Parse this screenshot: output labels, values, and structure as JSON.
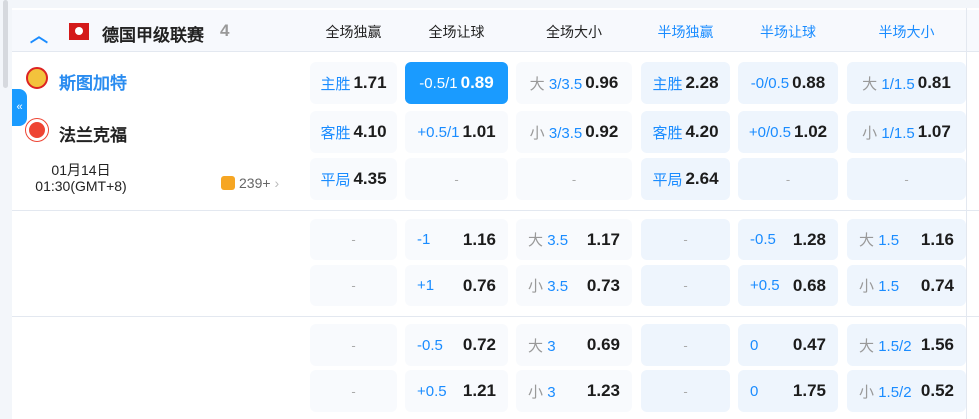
{
  "league": {
    "name": "德国甲级联赛",
    "count": "4",
    "flag_icon": "bundesliga-flag-icon"
  },
  "columns": [
    "全场独赢",
    "全场让球",
    "全场大小",
    "半场独赢",
    "半场让球",
    "半场大小"
  ],
  "match": {
    "home": "斯图加特",
    "away": "法兰克福",
    "date": "01月14日",
    "time": "01:30(GMT+8)",
    "more": "239+"
  },
  "rows": [
    [
      {
        "l": "主胜",
        "v": "1.71"
      },
      {
        "l": "-0.5/1",
        "v": "0.89",
        "selected": true
      },
      {
        "p": "大",
        "l": "3/3.5",
        "v": "0.96"
      },
      {
        "l": "主胜",
        "v": "2.28"
      },
      {
        "l": "-0/0.5",
        "v": "0.88"
      },
      {
        "p": "大",
        "l": "1/1.5",
        "v": "0.81"
      }
    ],
    [
      {
        "l": "客胜",
        "v": "4.10"
      },
      {
        "l": "+0.5/1",
        "v": "1.01"
      },
      {
        "p": "小",
        "l": "3/3.5",
        "v": "0.92"
      },
      {
        "l": "客胜",
        "v": "4.20"
      },
      {
        "l": "+0/0.5",
        "v": "1.02"
      },
      {
        "p": "小",
        "l": "1/1.5",
        "v": "1.07"
      }
    ],
    [
      {
        "l": "平局",
        "v": "4.35"
      },
      {
        "d": "-"
      },
      {
        "d": "-"
      },
      {
        "l": "平局",
        "v": "2.64"
      },
      {
        "d": "-"
      },
      {
        "d": "-"
      }
    ],
    [
      {
        "d": "-"
      },
      {
        "l": "-1",
        "v": "1.16"
      },
      {
        "p": "大",
        "l": "3.5",
        "v": "1.17"
      },
      {
        "d": "-"
      },
      {
        "l": "-0.5",
        "v": "1.28"
      },
      {
        "p": "大",
        "l": "1.5",
        "v": "1.16"
      }
    ],
    [
      {
        "d": "-"
      },
      {
        "l": "+1",
        "v": "0.76"
      },
      {
        "p": "小",
        "l": "3.5",
        "v": "0.73"
      },
      {
        "d": "-"
      },
      {
        "l": "+0.5",
        "v": "0.68"
      },
      {
        "p": "小",
        "l": "1.5",
        "v": "0.74"
      }
    ],
    [
      {
        "d": "-"
      },
      {
        "l": "-0.5",
        "v": "0.72"
      },
      {
        "p": "大",
        "l": "3",
        "v": "0.69"
      },
      {
        "d": "-"
      },
      {
        "l": "0",
        "v": "0.47"
      },
      {
        "p": "大",
        "l": "1.5/2",
        "v": "1.56"
      }
    ],
    [
      {
        "d": "-"
      },
      {
        "l": "+0.5",
        "v": "1.21"
      },
      {
        "p": "小",
        "l": "3",
        "v": "1.23"
      },
      {
        "d": "-"
      },
      {
        "l": "0",
        "v": "1.75"
      },
      {
        "p": "小",
        "l": "1.5/2",
        "v": "0.52"
      }
    ]
  ],
  "colors": {
    "accent": "#1a9bff",
    "header_bg": "#f7f9fd"
  }
}
